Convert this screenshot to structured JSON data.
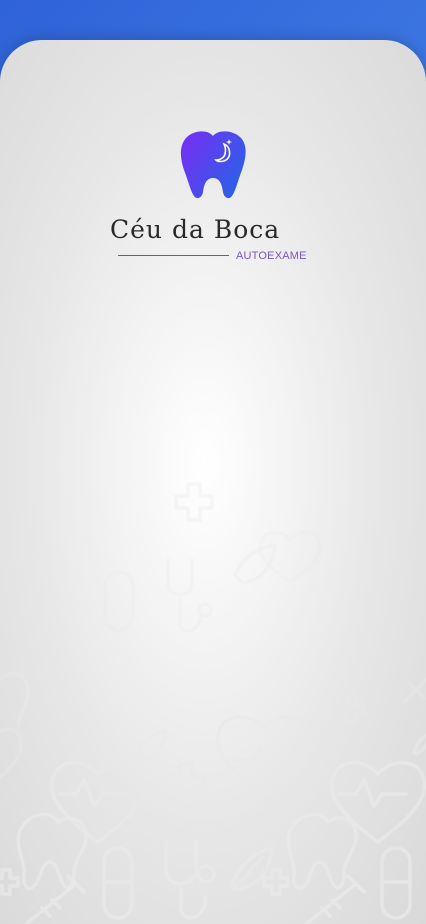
{
  "app": {
    "brand_title": "Céu da Boca",
    "brand_subtitle": "AUTOEXAME"
  },
  "colors": {
    "top_bar_start": "#2f63d8",
    "top_bar_end": "#5a93ea",
    "card_background": "#f3f3f3",
    "accent_purple": "#7a56c8",
    "tooth_gradient_start": "#7a2df4",
    "tooth_gradient_end": "#2f5de8"
  },
  "icons": [
    "tooth-icon",
    "moon-icon",
    "heartbeat-icon",
    "medical-cross-icon",
    "stethoscope-icon",
    "syringe-icon",
    "capsule-icon",
    "leaf-icon"
  ]
}
